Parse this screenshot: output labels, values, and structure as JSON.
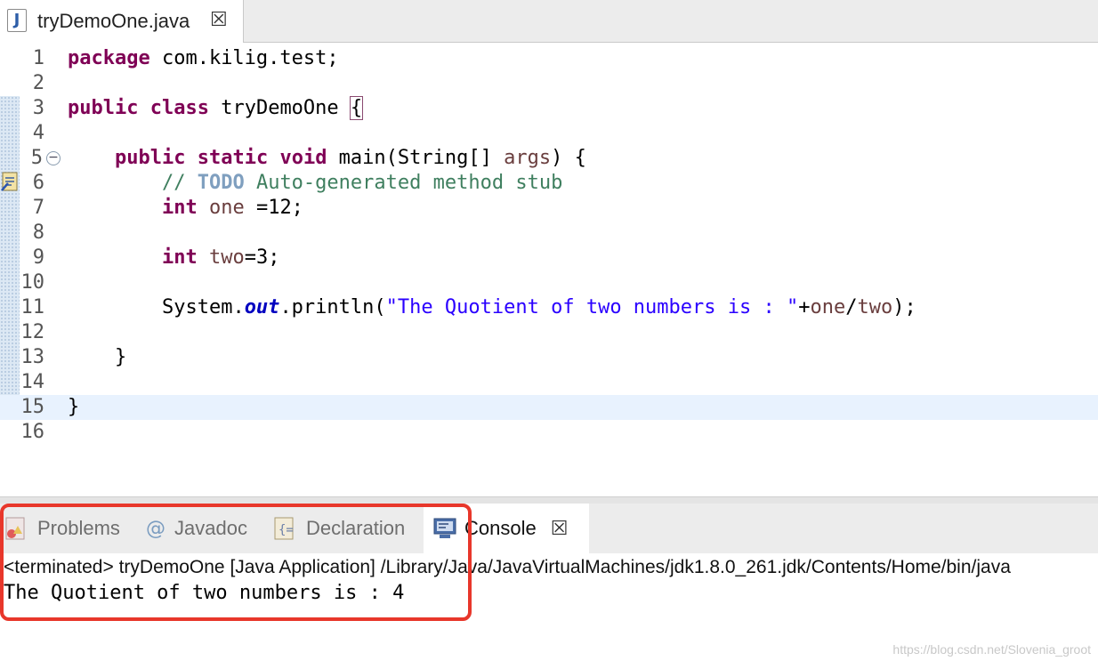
{
  "editor": {
    "tab_title": "tryDemoOne.java",
    "lines": [
      {
        "number": "1"
      },
      {
        "number": "2"
      },
      {
        "number": "3"
      },
      {
        "number": "4"
      },
      {
        "number": "5"
      },
      {
        "number": "6"
      },
      {
        "number": "7"
      },
      {
        "number": "8"
      },
      {
        "number": "9"
      },
      {
        "number": "10"
      },
      {
        "number": "11"
      },
      {
        "number": "12"
      },
      {
        "number": "13"
      },
      {
        "number": "14"
      },
      {
        "number": "15"
      },
      {
        "number": "16"
      }
    ],
    "code": {
      "l1_kw": "package",
      "l1_rest": " com.kilig.test;",
      "l3_kw1": "public",
      "l3_kw2": "class",
      "l3_name": " tryDemoOne ",
      "l3_brace": "{",
      "l5_kw1": "public",
      "l5_kw2": "static",
      "l5_kw3": "void",
      "l5_sig": " main(String[] ",
      "l5_arg": "args",
      "l5_end": ") {",
      "l6_cm1": "// ",
      "l6_todo": "TODO",
      "l6_cm2": " Auto-generated method stub",
      "l7_kw": "int",
      "l7_var": " one",
      "l7_rest": " =12;",
      "l9_kw": "int",
      "l9_var": " two",
      "l9_rest": "=3;",
      "l11_a": "System.",
      "l11_field": "out",
      "l11_b": ".println(",
      "l11_str": "\"The Quotient of two numbers is : \"",
      "l11_plus": "+",
      "l11_v1": "one",
      "l11_slash": "/",
      "l11_v2": "two",
      "l11_end": ");",
      "l13": "}",
      "l15": "}"
    }
  },
  "panel": {
    "tabs": [
      {
        "label": "Problems",
        "icon": "problems-icon"
      },
      {
        "label": "Javadoc",
        "icon": "javadoc-at-icon"
      },
      {
        "label": "Declaration",
        "icon": "declaration-icon"
      },
      {
        "label": "Console",
        "icon": "console-monitor-icon",
        "active": true
      }
    ],
    "console_description": "<terminated> tryDemoOne [Java Application] /Library/Java/JavaVirtualMachines/jdk1.8.0_261.jdk/Contents/Home/bin/java",
    "console_output": "The Quotient of two numbers is : 4"
  },
  "watermark": "https://blog.csdn.net/Slovenia_groot",
  "colors": {
    "keyword": "#7f0055",
    "comment": "#3f7f5f",
    "string": "#2a00ff",
    "highlight_box": "#e8372b"
  }
}
